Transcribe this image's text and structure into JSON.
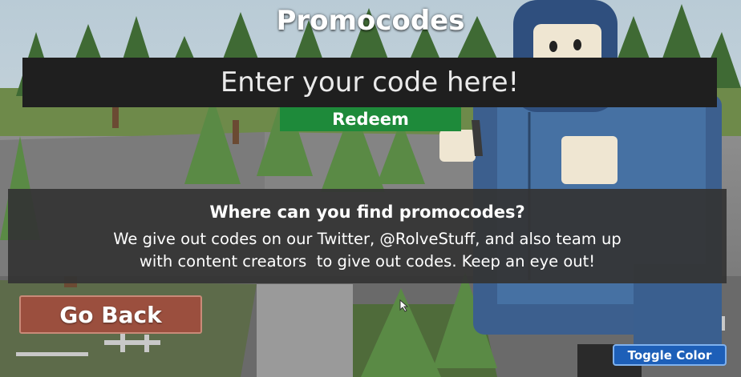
{
  "title": "Promocodes",
  "code_input": {
    "placeholder": "Enter your code here!",
    "value": ""
  },
  "redeem_label": "Redeem",
  "info": {
    "heading": "Where can you find promocodes?",
    "lines": [
      "We give out codes on our Twitter, @RolveStuff, and also team up",
      "with content creators  to give out codes. Keep an eye out!"
    ]
  },
  "go_back_label": "Go Back",
  "toggle_color_label": "Toggle Color",
  "colors": {
    "input_bg": "#1f1f1f",
    "redeem_bg": "#1e8a3a",
    "info_bg": "#343434",
    "go_back_bg": "#9b4f3e",
    "toggle_bg": "#1d5fb8"
  }
}
